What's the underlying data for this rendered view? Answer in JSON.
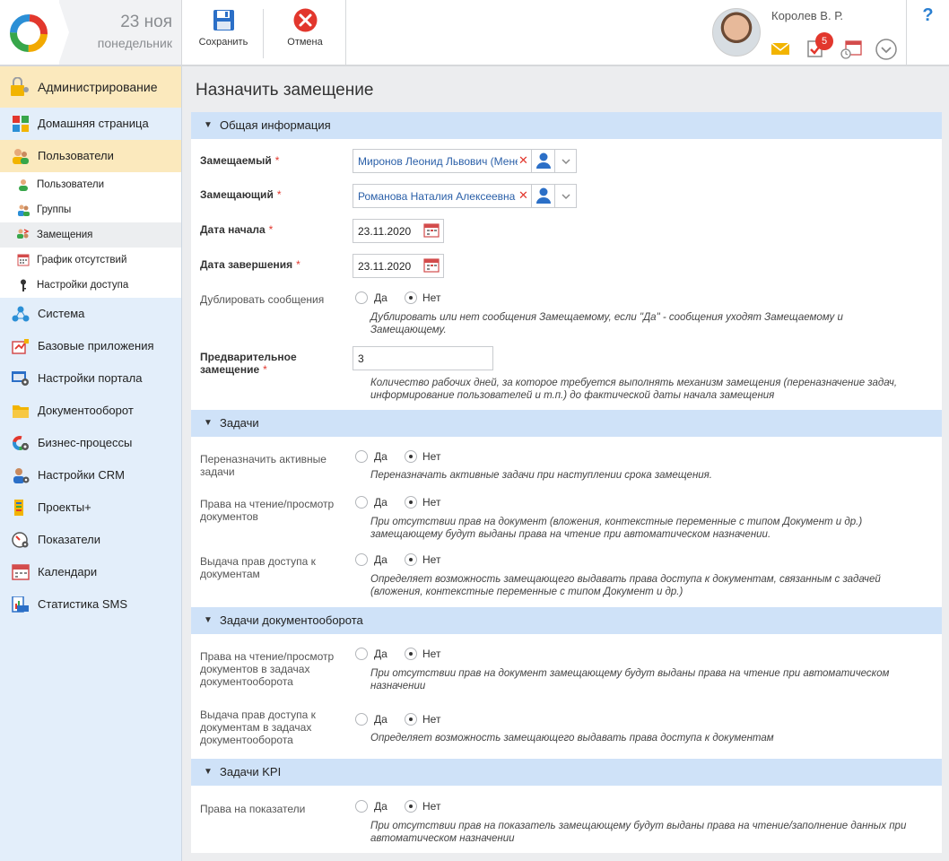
{
  "header": {
    "date_day": "23 ноя",
    "date_weekday": "понедельник",
    "save_label": "Сохранить",
    "cancel_label": "Отмена",
    "user_name": "Королев В. Р.",
    "tasks_badge": "5",
    "help": "?"
  },
  "sidebar": {
    "admin": "Администрирование",
    "items": [
      {
        "label": "Домашняя страница"
      },
      {
        "label": "Пользователи"
      }
    ],
    "sub": [
      {
        "label": "Пользователи"
      },
      {
        "label": "Группы"
      },
      {
        "label": "Замещения"
      },
      {
        "label": "График отсутствий"
      },
      {
        "label": "Настройки доступа"
      }
    ],
    "rest": [
      {
        "label": "Система"
      },
      {
        "label": "Базовые приложения"
      },
      {
        "label": "Настройки портала"
      },
      {
        "label": "Документооборот"
      },
      {
        "label": "Бизнес-процессы"
      },
      {
        "label": "Настройки CRM"
      },
      {
        "label": "Проекты+"
      },
      {
        "label": "Показатели"
      },
      {
        "label": "Календари"
      },
      {
        "label": "Статистика SMS"
      }
    ]
  },
  "page": {
    "title": "Назначить замещение"
  },
  "form": {
    "yes": "Да",
    "no": "Нет",
    "general": {
      "header": "Общая информация",
      "substituted_label": "Замещаемый",
      "substituted_value": "Миронов Леонид Львович (Менеджер)",
      "substitute_label": "Замещающий",
      "substitute_value": "Романова Наталия Алексеевна",
      "start_label": "Дата начала",
      "start_value": "23.11.2020",
      "end_label": "Дата завершения",
      "end_value": "23.11.2020",
      "dup_label": "Дублировать сообщения",
      "dup_hint": "Дублировать или нет сообщения Замещаемому, если \"Да\" - сообщения уходят Замещаемому и Замещающему.",
      "pre_label": "Предварительное замещение",
      "pre_value": "3",
      "pre_hint": "Количество рабочих дней, за которое требуется выполнять механизм замещения (переназначение задач, информирование пользователей и т.п.) до фактической даты начала замещения"
    },
    "tasks": {
      "header": "Задачи",
      "reassign_label": "Переназначить активные задачи",
      "reassign_hint": "Переназначать активные задачи при наступлении срока замещения.",
      "read_label": "Права на чтение/просмотр документов",
      "read_hint": "При отсутствии прав на документ (вложения, контекстные переменные с типом Документ и др.) замещающему будут выданы права на чтение при автоматическом назначении.",
      "grant_label": "Выдача прав доступа к документам",
      "grant_hint": "Определяет возможность замещающего выдавать права доступа к документам, связанным с задачей (вложения, контекстные переменные с типом Документ и др.)"
    },
    "doc_tasks": {
      "header": "Задачи документооборота",
      "read_label": "Права на чтение/просмотр документов в задачах документооборота",
      "read_hint": "При отсутствии прав на документ замещающему будут выданы права на чтение при автоматическом назначении",
      "grant_label": "Выдача прав доступа к документам в задачах документооборота",
      "grant_hint": "Определяет возможность замещающего выдавать права доступа к документам"
    },
    "kpi": {
      "header": "Задачи KPI",
      "rights_label": "Права на показатели",
      "rights_hint": "При отсутствии прав на показатель замещающему будут выданы права на чтение/заполнение данных при автоматическом назначении"
    }
  }
}
